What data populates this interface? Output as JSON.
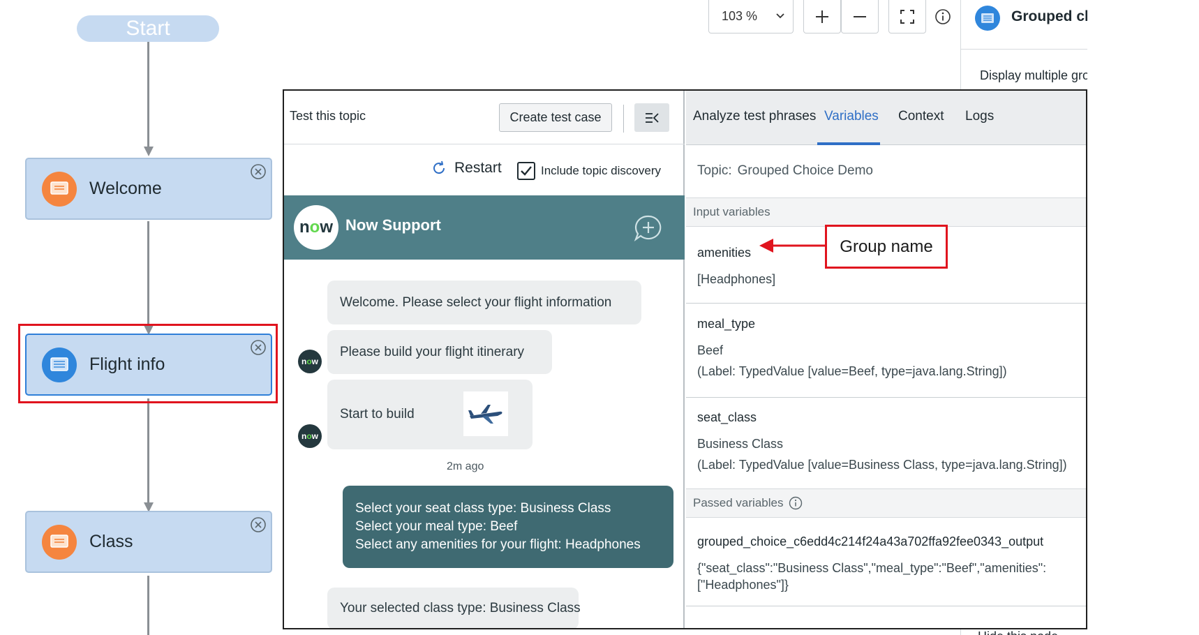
{
  "flow": {
    "start_label": "Start",
    "nodes": [
      {
        "label": "Welcome",
        "icon": "message-icon",
        "color": "#f5853f"
      },
      {
        "label": "Flight info",
        "icon": "list-icon",
        "color": "#2f86dc",
        "selected": true
      },
      {
        "label": "Class",
        "icon": "message-icon",
        "color": "#f5853f"
      }
    ]
  },
  "toolbar": {
    "zoom": "103 %",
    "zoom_in_icon": "plus-icon",
    "zoom_out_icon": "minus-icon",
    "fit_icon": "fit-screen-icon",
    "info_icon": "info-icon"
  },
  "properties": {
    "title": "Grouped choice",
    "description": "Display multiple groups",
    "bottom_text": "Hide this node"
  },
  "test_panel": {
    "title": "Test this topic",
    "create_button": "Create test case",
    "restart_label": "Restart",
    "include_discovery_label": "Include topic discovery",
    "include_discovery_checked": true,
    "chat": {
      "brand_logo": "now",
      "name": "Now Support",
      "messages": {
        "welcome": "Welcome. Please select your flight information",
        "build": "Please build your flight itinerary",
        "start_build": "Start to build",
        "timestamp": "2m ago",
        "user_lines": [
          "Select your seat class type: Business Class",
          "Select your meal type: Beef",
          "Select any amenities for your flight: Headphones"
        ],
        "selected_class": "Your selected class type: Business Class"
      }
    }
  },
  "variables_panel": {
    "tabs": [
      {
        "label": "Analyze test phrases",
        "active": false
      },
      {
        "label": "Variables",
        "active": true
      },
      {
        "label": "Context",
        "active": false
      },
      {
        "label": "Logs",
        "active": false
      }
    ],
    "topic_label": "Topic:",
    "topic_value": "Grouped Choice Demo",
    "input_section": "Input variables",
    "input_vars": [
      {
        "name": "amenities",
        "value": "[Headphones]",
        "label": ""
      },
      {
        "name": "meal_type",
        "value": "Beef",
        "label": "(Label: TypedValue [value=Beef, type=java.lang.String])"
      },
      {
        "name": "seat_class",
        "value": "Business Class",
        "label": "(Label: TypedValue [value=Business Class, type=java.lang.String])"
      }
    ],
    "passed_section": "Passed variables",
    "passed_var": {
      "name": "grouped_choice_c6edd4c214f24a43a702ffa92fee0343_output",
      "value_line1": "{\"seat_class\":\"Business Class\",\"meal_type\":\"Beef\",\"amenities\":",
      "value_line2": "[\"Headphones\"]}"
    }
  },
  "annotation": {
    "callout": "Group name",
    "color": "#e0141e"
  }
}
